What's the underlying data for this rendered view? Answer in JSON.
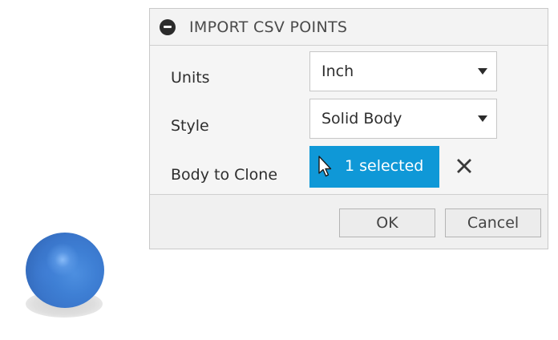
{
  "dialog": {
    "title": "IMPORT CSV POINTS",
    "collapse_icon": "collapse-minus-icon",
    "fields": {
      "units": {
        "label": "Units",
        "value": "Inch"
      },
      "style": {
        "label": "Style",
        "value": "Solid Body"
      },
      "body_to_clone": {
        "label": "Body to Clone",
        "selection": "1 selected",
        "cursor_icon": "pointer-arrow-icon",
        "clear_icon": "clear-x-icon"
      }
    },
    "buttons": {
      "ok": "OK",
      "cancel": "Cancel"
    }
  },
  "canvas": {
    "object": "sphere",
    "object_color": "#3e7fd4"
  },
  "colors": {
    "selection_active": "#0f98d7",
    "dialog_bg": "#f0f0f0"
  }
}
